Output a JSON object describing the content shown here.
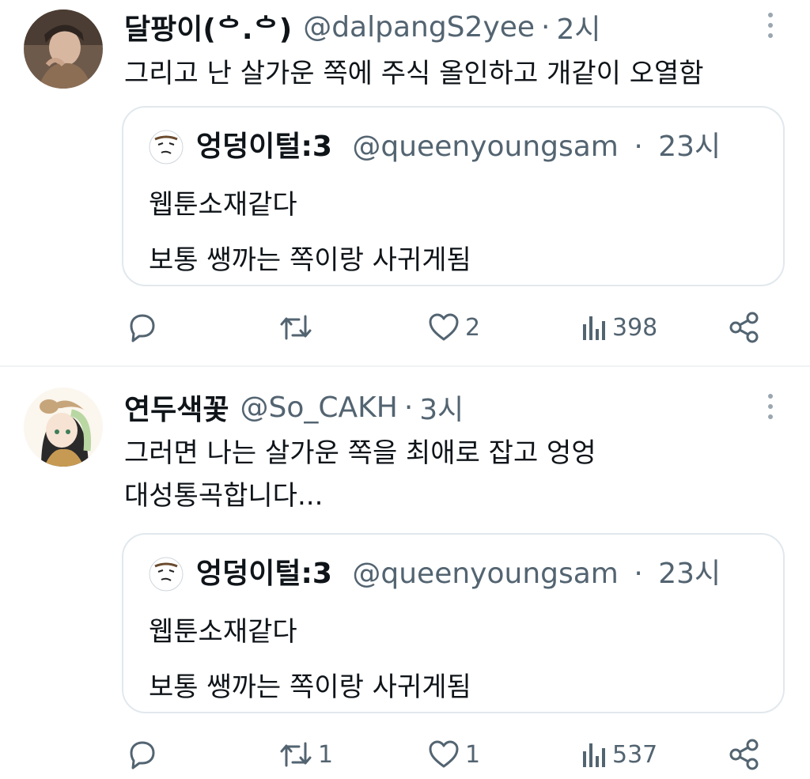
{
  "tweets": [
    {
      "display_name": "달팡이(ᅌ.ᅌ)",
      "handle": "@dalpangS2yee",
      "time": "2시",
      "text_lines": [
        "그리고 난 살가운 쪽에 주식 올인하고 개같이 오열함"
      ],
      "quote": {
        "display_name": "엉덩이털:3",
        "handle": "@queenyoungsam",
        "time": "23시",
        "text_lines": [
          "웹툰소재같다",
          "보통 쌩까는 쪽이랑 사귀게됨"
        ]
      },
      "actions": {
        "replies": "",
        "retweets": "",
        "likes": "2",
        "views": "398"
      }
    },
    {
      "display_name": "연두색꽃",
      "handle": "@So_CAKH",
      "time": "3시",
      "text_lines": [
        "그러면 나는 살가운 쪽을 최애로 잡고 엉엉",
        "대성통곡합니다..."
      ],
      "quote": {
        "display_name": "엉덩이털:3",
        "handle": "@queenyoungsam",
        "time": "23시",
        "text_lines": [
          "웹툰소재같다",
          "보통 쌩까는 쪽이랑 사귀게됨"
        ]
      },
      "actions": {
        "replies": "",
        "retweets": "1",
        "likes": "1",
        "views": "537"
      }
    }
  ],
  "separator": "·",
  "colors": {
    "text": "#0f1419",
    "secondary": "#536471",
    "border": "#e1e8ed",
    "divider": "#eff3f4"
  },
  "icons": [
    "reply-icon",
    "retweet-icon",
    "like-icon",
    "views-icon",
    "share-icon",
    "more-icon"
  ]
}
